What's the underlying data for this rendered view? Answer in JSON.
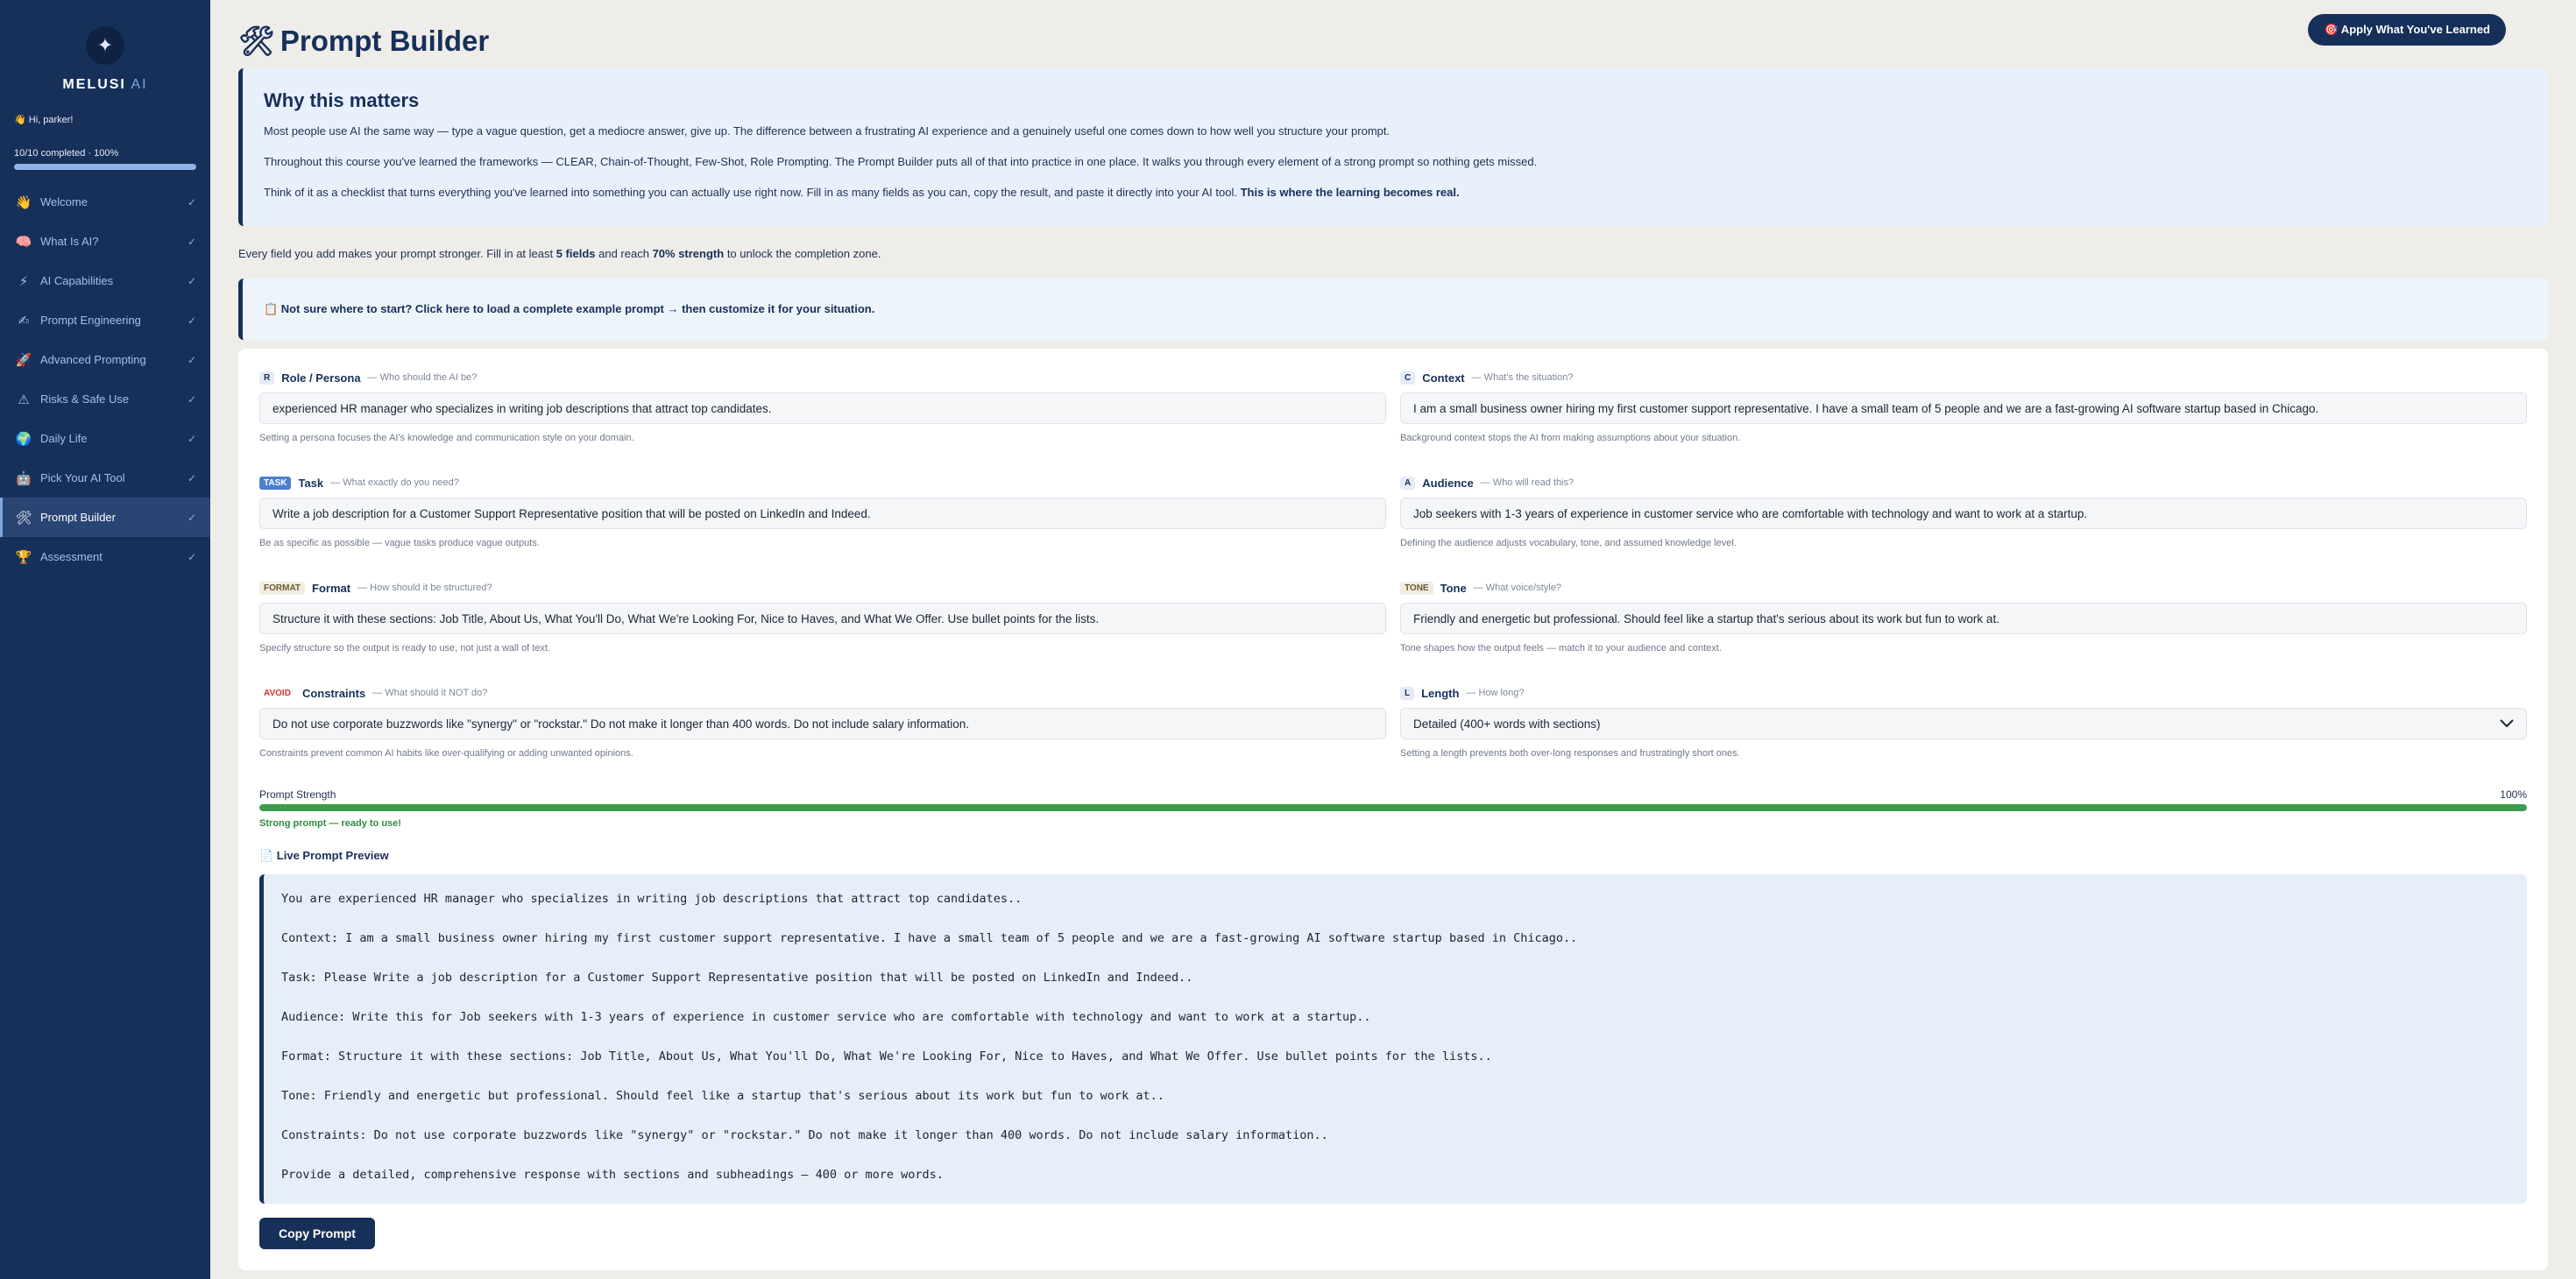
{
  "sidebar": {
    "logo_icon": "✦",
    "brand": "MELUSI",
    "brand_suffix": " AI",
    "greeting": "👋 Hi, parker!",
    "progress_label": "10/10 completed · 100%",
    "progress_fraction": 1.0,
    "items": [
      {
        "label": "Welcome",
        "icon": "👋",
        "check": "✓"
      },
      {
        "label": "What Is AI?",
        "icon": "🧠",
        "check": "✓"
      },
      {
        "label": "AI Capabilities",
        "icon": "⚡",
        "check": "✓"
      },
      {
        "label": "Prompt Engineering",
        "icon": "✍",
        "check": "✓"
      },
      {
        "label": "Advanced Prompting",
        "icon": "🚀",
        "check": "✓"
      },
      {
        "label": "Risks & Safe Use",
        "icon": "⚠",
        "check": "✓"
      },
      {
        "label": "Daily Life",
        "icon": "🌍",
        "check": "✓"
      },
      {
        "label": "Pick Your AI Tool",
        "icon": "🤖",
        "check": "✓"
      },
      {
        "label": "Prompt Builder",
        "icon": "🛠",
        "check": "✓"
      },
      {
        "label": "Assessment",
        "icon": "🏆",
        "check": "✓"
      }
    ],
    "active_index": 8
  },
  "header": {
    "title_icon": "🛠",
    "title": "Prompt Builder",
    "apply_button": "🎯 Apply What You've Learned"
  },
  "why": {
    "title": "Why this matters",
    "p1": "Most people use AI the same way — type a vague question, get a mediocre answer, give up. The difference between a frustrating AI experience and a genuinely useful one comes down to how well you structure your prompt.",
    "p2": "Throughout this course you've learned the frameworks — CLEAR, Chain-of-Thought, Few-Shot, Role Prompting. The Prompt Builder puts all of that into practice in one place. It walks you through every element of a strong prompt so nothing gets missed.",
    "p3": "Think of it as a checklist that turns everything you've learned into something you can actually use right now. Fill in as many fields as you can, copy the result, and paste it directly into your AI tool.",
    "p3_bold": "This is where the learning becomes real."
  },
  "hint": {
    "pre": "Every field you add makes your prompt stronger. Fill in at least ",
    "fields": "5 fields",
    "mid": " and reach ",
    "strength": "70% strength",
    "post": " to unlock the completion zone."
  },
  "example_banner": "📋 Not sure where to start? Click here to load a complete example prompt → then customize it for your situation.",
  "fields": {
    "role": {
      "badge": "R",
      "name": "Role / Persona",
      "q": "— Who should the AI be?",
      "value": "experienced HR manager who specializes in writing job descriptions that attract top candidates.",
      "help": "Setting a persona focuses the AI's knowledge and communication style on your domain."
    },
    "context": {
      "badge": "C",
      "name": "Context",
      "q": "— What's the situation?",
      "value": "I am a small business owner hiring my first customer support representative. I have a small team of 5 people and we are a fast-growing AI software startup based in Chicago.",
      "help": "Background context stops the AI from making assumptions about your situation."
    },
    "task": {
      "badge": "TASK",
      "name": "Task",
      "q": "— What exactly do you need?",
      "value": "Write a job description for a Customer Support Representative position that will be posted on LinkedIn and Indeed.",
      "help": "Be as specific as possible — vague tasks produce vague outputs."
    },
    "audience": {
      "badge": "A",
      "name": "Audience",
      "q": "— Who will read this?",
      "value": "Job seekers with 1-3 years of experience in customer service who are comfortable with technology and want to work at a startup.",
      "help": "Defining the audience adjusts vocabulary, tone, and assumed knowledge level."
    },
    "format": {
      "badge": "FORMAT",
      "name": "Format",
      "q": "— How should it be structured?",
      "value": "Structure it with these sections: Job Title, About Us, What You'll Do, What We're Looking For, Nice to Haves, and What We Offer. Use bullet points for the lists.",
      "help": "Specify structure so the output is ready to use, not just a wall of text."
    },
    "tone": {
      "badge": "TONE",
      "name": "Tone",
      "q": "— What voice/style?",
      "value": "Friendly and energetic but professional. Should feel like a startup that's serious about its work but fun to work at.",
      "help": "Tone shapes how the output feels — match it to your audience and context."
    },
    "constraints": {
      "badge": "AVOID",
      "name": "Constraints",
      "q": "— What should it NOT do?",
      "value": "Do not use corporate buzzwords like \"synergy\" or \"rockstar.\" Do not make it longer than 400 words. Do not include salary information.",
      "help": "Constraints prevent common AI habits like over-qualifying or adding unwanted opinions."
    },
    "length": {
      "badge": "L",
      "name": "Length",
      "q": "— How long?",
      "value": "Detailed (400+ words with sections)",
      "help": "Setting a length prevents both over-long responses and frustratingly short ones."
    }
  },
  "strength": {
    "label": "Prompt Strength",
    "percent_text": "100%",
    "fraction": 1.0,
    "message": "Strong prompt — ready to use!",
    "color": "#3f9c4e"
  },
  "preview": {
    "title": "📄 Live Prompt Preview",
    "lines": [
      "You are experienced HR manager who specializes in writing job descriptions that attract top candidates..",
      "Context: I am a small business owner hiring my first customer support representative. I have a small team of 5 people and we are a fast-growing AI software startup based in Chicago..",
      "Task: Please Write a job description for a Customer Support Representative position that will be posted on LinkedIn and Indeed..",
      "Audience: Write this for Job seekers with 1-3 years of experience in customer service who are comfortable with technology and want to work at a startup..",
      "Format: Structure it with these sections: Job Title, About Us, What You'll Do, What We're Looking For, Nice to Haves, and What We Offer. Use bullet points for the lists..",
      "Tone: Friendly and energetic but professional. Should feel like a startup that's serious about its work but fun to work at..",
      "Constraints: Do not use corporate buzzwords like \"synergy\" or \"rockstar.\" Do not make it longer than 400 words. Do not include salary information..",
      "Provide a detailed, comprehensive response with sections and subheadings — 400 or more words."
    ]
  },
  "copy_button": "Copy Prompt",
  "colors": {
    "navy": "#17305a",
    "accent": "#7fa6e0",
    "success": "#3f9c4e",
    "avoid": "#d33636"
  }
}
